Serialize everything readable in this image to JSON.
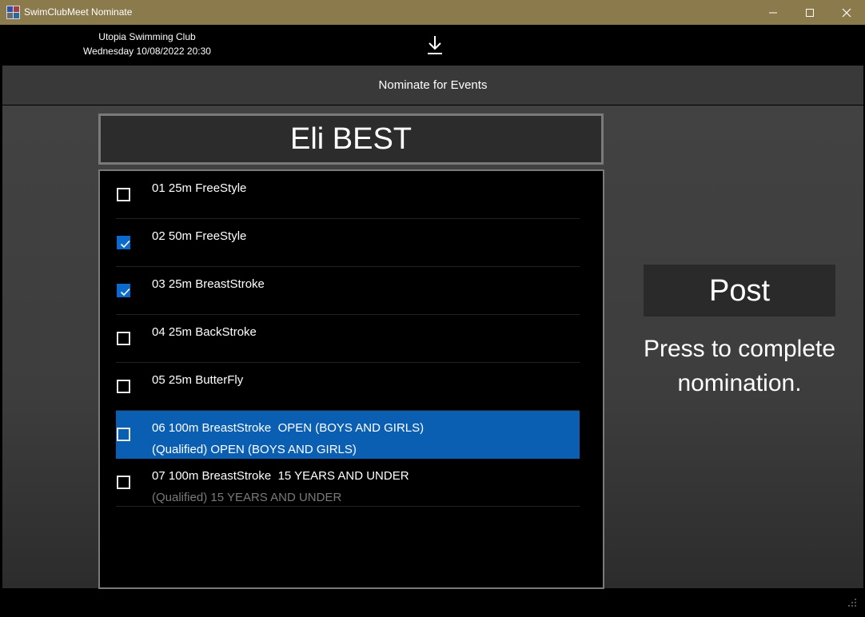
{
  "window": {
    "title": "SwimClubMeet Nominate",
    "controls": {
      "minimize": "minimize-icon",
      "maximize": "maximize-icon",
      "close": "close-icon"
    }
  },
  "header": {
    "club_name": "Utopia Swimming Club",
    "session_datetime": "Wednesday 10/08/2022 20:30",
    "action_icon": "download-icon"
  },
  "page_title": "Nominate for Events",
  "swimmer_name": "Eli BEST",
  "events": [
    {
      "label": "01 25m FreeStyle",
      "sub": "",
      "checked": false,
      "selected": false
    },
    {
      "label": "02 50m FreeStyle",
      "sub": "",
      "checked": true,
      "selected": false
    },
    {
      "label": "03 25m BreastStroke",
      "sub": "",
      "checked": true,
      "selected": false
    },
    {
      "label": "04 25m BackStroke",
      "sub": "",
      "checked": false,
      "selected": false
    },
    {
      "label": "05 25m ButterFly",
      "sub": "",
      "checked": false,
      "selected": false
    },
    {
      "label": "06 100m BreastStroke  OPEN (BOYS AND GIRLS)",
      "sub": "(Qualified) OPEN (BOYS AND GIRLS)",
      "checked": false,
      "selected": true
    },
    {
      "label": "07 100m BreastStroke  15 YEARS AND UNDER",
      "sub": "(Qualified) 15 YEARS AND UNDER",
      "checked": false,
      "selected": false
    }
  ],
  "post": {
    "label": "Post",
    "hint": "Press to complete nomination."
  },
  "colors": {
    "titlebar": "#8a7a4c",
    "selection": "#0a5fb3",
    "checkbox_checked": "#0b6acb"
  }
}
